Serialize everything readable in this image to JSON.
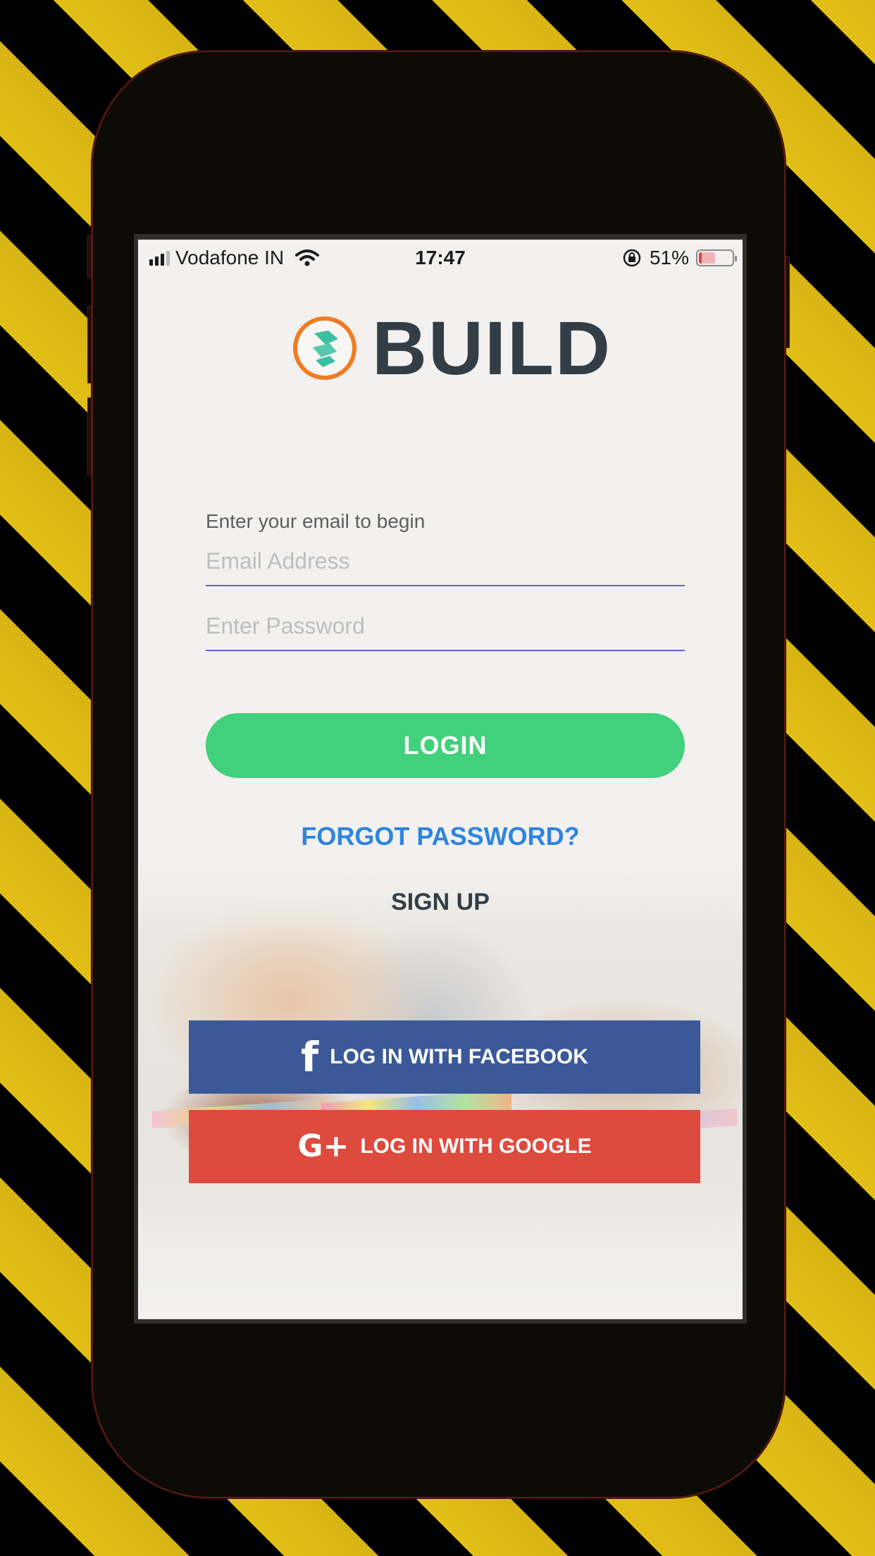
{
  "status_bar": {
    "carrier": "Vodafone IN",
    "time": "17:47",
    "battery": "51%",
    "battery_level": 0.51
  },
  "logo": {
    "text": "BUILD",
    "ring_color": "#ef7b23",
    "mark_color": "#3bbfa0",
    "text_color": "#333d45"
  },
  "form": {
    "prompt": "Enter your email to begin",
    "email_placeholder": "Email Address",
    "password_placeholder": "Enter Password"
  },
  "actions": {
    "login_label": "LOGIN",
    "forgot_label": "FORGOT PASSWORD?",
    "signup_label": "SIGN UP"
  },
  "social": {
    "facebook_label": "LOG IN WITH FACEBOOK",
    "facebook_icon": "f",
    "google_label": "LOG IN WITH GOOGLE",
    "google_icon": "G+"
  },
  "colors": {
    "login_green": "#41d07b",
    "link_blue": "#2f84e0",
    "facebook_blue": "#3b5998",
    "google_red": "#dd4b3e",
    "field_underline": "#6a5fd0"
  }
}
